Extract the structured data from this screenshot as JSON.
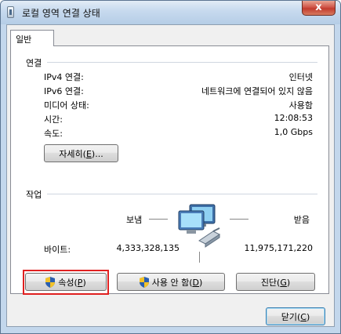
{
  "window": {
    "title": "로컬 영역 연결 상태",
    "close_glyph": "x"
  },
  "tab": {
    "label": "일반"
  },
  "connection": {
    "heading": "연결",
    "rows": [
      {
        "label": "IPv4 연결:",
        "value": "인터넷"
      },
      {
        "label": "IPv6 연결:",
        "value": "네트워크에 연결되어 있지 않음"
      },
      {
        "label": "미디어 상태:",
        "value": "사용함"
      },
      {
        "label": "시간:",
        "value": "12:08:53"
      },
      {
        "label": "속도:",
        "value": "1,0 Gbps"
      }
    ],
    "details_button": {
      "text": "자세히(",
      "accel": "E",
      "tail": ")..."
    }
  },
  "activity": {
    "heading": "작업",
    "sent_label": "보냄",
    "received_label": "받음",
    "bytes_label": "바이트:",
    "bytes_sent": "4,333,328,135",
    "bytes_received": "11,975,171,220"
  },
  "buttons": {
    "properties": {
      "text": "속성(",
      "accel": "P",
      "tail": ")"
    },
    "disable": {
      "text": "사용 안 함(",
      "accel": "D",
      "tail": ")"
    },
    "diagnose": {
      "text": "진단(",
      "accel": "G",
      "tail": ")"
    },
    "close": {
      "text": "닫기(",
      "accel": "C",
      "tail": ")"
    }
  },
  "colors": {
    "highlight": "#e02020",
    "shield_blue": "#2a5fb0",
    "shield_yellow": "#f2c22a"
  }
}
